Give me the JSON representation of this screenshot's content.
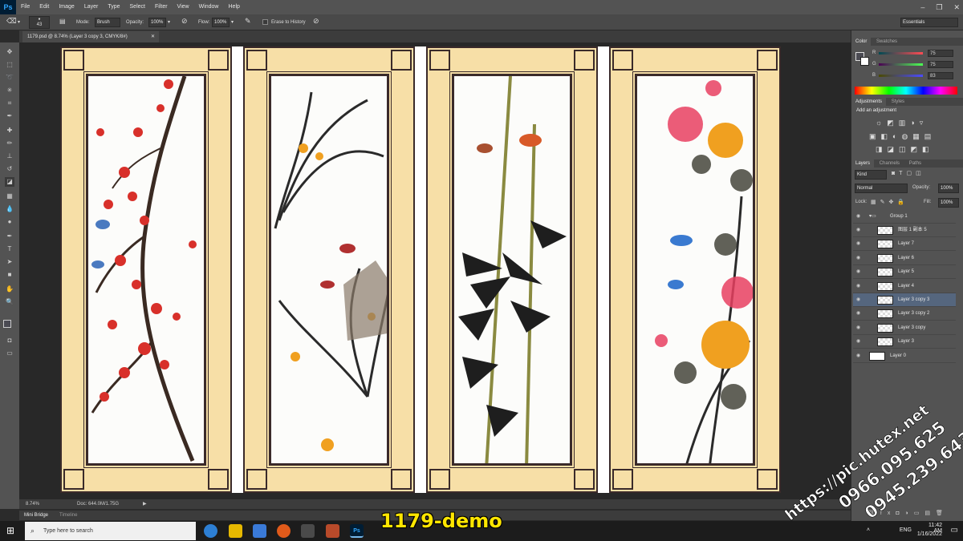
{
  "app": {
    "logo": "Ps"
  },
  "menubar": {
    "items": [
      "File",
      "Edit",
      "Image",
      "Layer",
      "Type",
      "Select",
      "Filter",
      "View",
      "Window",
      "Help"
    ]
  },
  "window_controls": {
    "minimize": "–",
    "restore": "❐",
    "close": "✕"
  },
  "options": {
    "brush_size": "43",
    "mode_label": "Mode:",
    "mode_value": "Brush",
    "opacity_label": "Opacity:",
    "opacity_value": "100%",
    "flow_label": "Flow:",
    "flow_value": "100%",
    "erase_history": "Erase to History",
    "workspace": "Essentials"
  },
  "document": {
    "tab_title": "1179.psd @ 8.74% (Layer 3 copy 3, CMYK/8#)",
    "zoom": "8.74%",
    "doc_size": "Doc: 644.0M/1.75G"
  },
  "bottom_tabs": [
    "Mini Bridge",
    "Timeline"
  ],
  "color_panel": {
    "tabs": [
      "Color",
      "Swatches"
    ],
    "channels": [
      {
        "label": "R",
        "value": "75"
      },
      {
        "label": "G",
        "value": "75"
      },
      {
        "label": "B",
        "value": "83"
      }
    ]
  },
  "adjustments": {
    "tabs": [
      "Adjustments",
      "Styles"
    ],
    "heading": "Add an adjustment"
  },
  "layers_panel": {
    "tabs": [
      "Layers",
      "Channels",
      "Paths"
    ],
    "kind": "Kind",
    "blend_mode": "Normal",
    "opacity_label": "Opacity:",
    "opacity_value": "100%",
    "lock_label": "Lock:",
    "fill_label": "Fill:",
    "fill_value": "100%",
    "group_name": "Group 1",
    "layers": [
      "图层 1 副本 5",
      "Layer 7",
      "Layer 6",
      "Layer 5",
      "Layer 4",
      "Layer 3 copy 3",
      "Layer 3 copy 2",
      "Layer 3 copy",
      "Layer 3",
      "Layer 0"
    ],
    "selected": "Layer 3 copy 3"
  },
  "taskbar": {
    "search_placeholder": "Type here to search",
    "language": "ENG",
    "time": "11:42 AM",
    "date": "1/16/2022"
  },
  "overlay": {
    "demo_label": "1179-demo",
    "watermark_lines": [
      "https://pic.hutex.net",
      "0966.095.625",
      "0945.239.643"
    ]
  },
  "colors": {
    "frame": "#f7dfa7",
    "lattice": "#3a2a2a",
    "plum": "#d8302a",
    "chrysanthemum": "#f0a020"
  }
}
